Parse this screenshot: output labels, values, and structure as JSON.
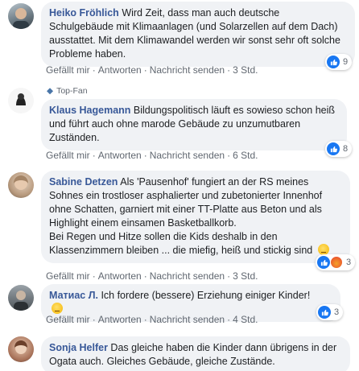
{
  "comments": [
    {
      "author": "Heiko Fröhlich",
      "text": "Wird Zeit, dass man auch deutsche Schulgebäude mit Klimaanlagen (und Solarzellen auf dem Dach) ausstattet. Mit dem Klimawandel werden wir sonst sehr oft solche Probleme haben.",
      "like": "Gefällt mir",
      "reply": "Antworten",
      "message": "Nachricht senden",
      "time": "3 Std.",
      "reactions": "9"
    },
    {
      "badge": "Top-Fan",
      "author": "Klaus Hagemann",
      "text": "Bildungspolitisch läuft es sowieso schon heiß und führt auch ohne marode Gebäude zu unzumutbaren Zuständen.",
      "like": "Gefällt mir",
      "reply": "Antworten",
      "message": "Nachricht senden",
      "time": "6 Std.",
      "reactions": "8"
    },
    {
      "author": "Sabine Detzen",
      "text": "Als 'Pausenhof' fungiert an der RS meines Sohnes ein trostloser asphalierter und zubetonierter Innenhof ohne Schatten, garniert mit einer TT-Platte aus Beton und als Highlight einem einsamen Basketballkorb.",
      "text2": "Bei Regen und Hitze sollen die Kids deshalb in den Klassenzimmern bleiben ... die miefig, heiß und stickig sind",
      "like": "Gefällt mir",
      "reply": "Antworten",
      "message": "Nachricht senden",
      "time": "3 Std.",
      "reactions": "3"
    },
    {
      "author": "Матиас Л.",
      "text": "Ich fordere (bessere) Erziehung einiger Kinder!",
      "like": "Gefällt mir",
      "reply": "Antworten",
      "message": "Nachricht senden",
      "time": "4 Std.",
      "reactions": "3"
    },
    {
      "author": "Sonja Helfer",
      "text": "Das gleiche haben die Kinder dann übrigens in der Ogata auch. Gleiches Gebäude, gleiche Zustände."
    }
  ],
  "colors": {
    "bubble": "#f0f2f5",
    "author": "#385898",
    "meta": "#606770",
    "like": "#1877f2"
  }
}
